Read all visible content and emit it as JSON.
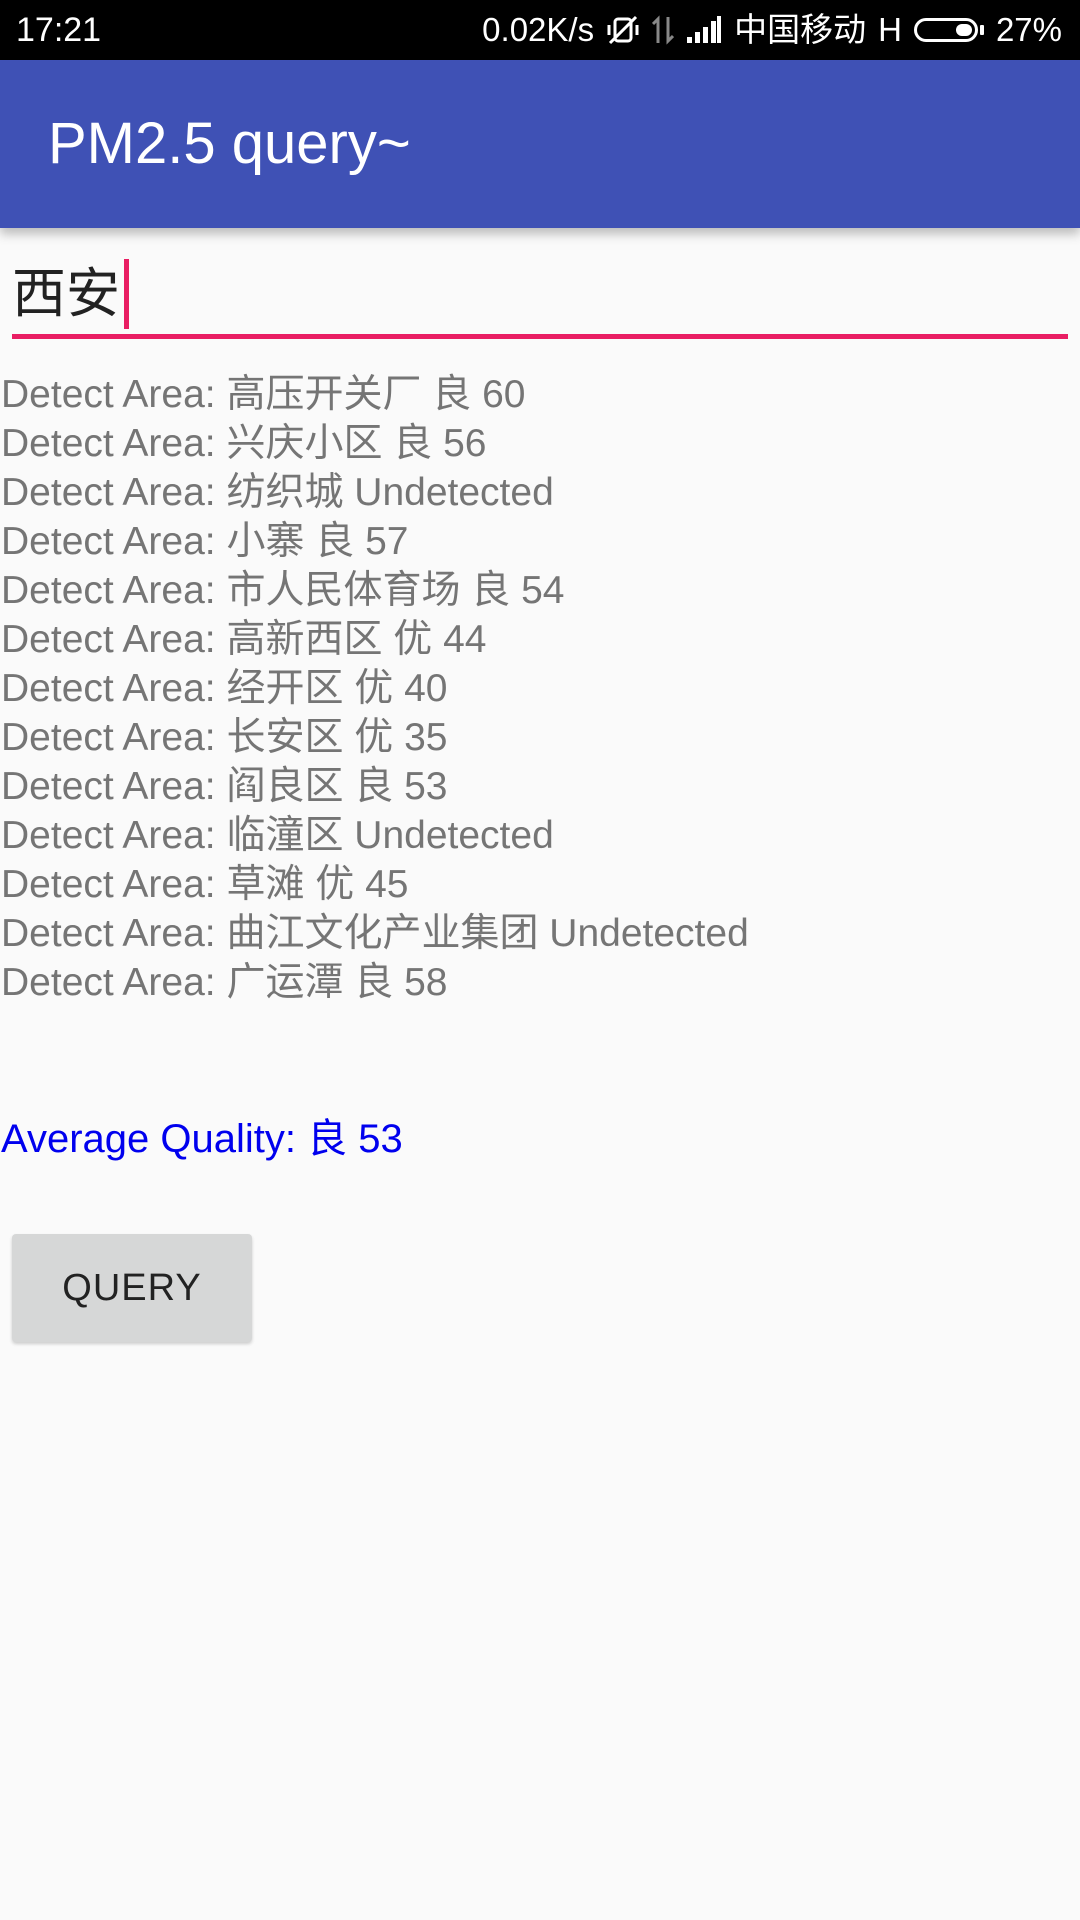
{
  "status_bar": {
    "time": "17:21",
    "net_speed": "0.02K/s",
    "carrier": "中国移动",
    "network_type": "H",
    "battery": "27%",
    "icons": [
      "vibrate-off-icon",
      "data-arrows-icon",
      "signal-icon",
      "battery-icon"
    ]
  },
  "app_bar": {
    "title": "PM2.5 query~",
    "color": "#3f51b5"
  },
  "input": {
    "value": "西安",
    "accent_color": "#e91e63"
  },
  "results": [
    "Detect Area: 高压开关厂 良 60",
    "Detect Area: 兴庆小区 良 56",
    "Detect Area: 纺织城 Undetected",
    "Detect Area: 小寨 良 57",
    "Detect Area: 市人民体育场 良 54",
    "Detect Area: 高新西区 优 44",
    "Detect Area: 经开区 优 40",
    "Detect Area: 长安区 优 35",
    "Detect Area: 阎良区 良 53",
    "Detect Area: 临潼区 Undetected",
    "Detect Area: 草滩 优 45",
    "Detect Area: 曲江文化产业集团 Undetected",
    "Detect Area: 广运潭 良 58"
  ],
  "average": {
    "text": "Average Quality: 良 53",
    "color": "#0000ee"
  },
  "button": {
    "label": "QUERY"
  }
}
